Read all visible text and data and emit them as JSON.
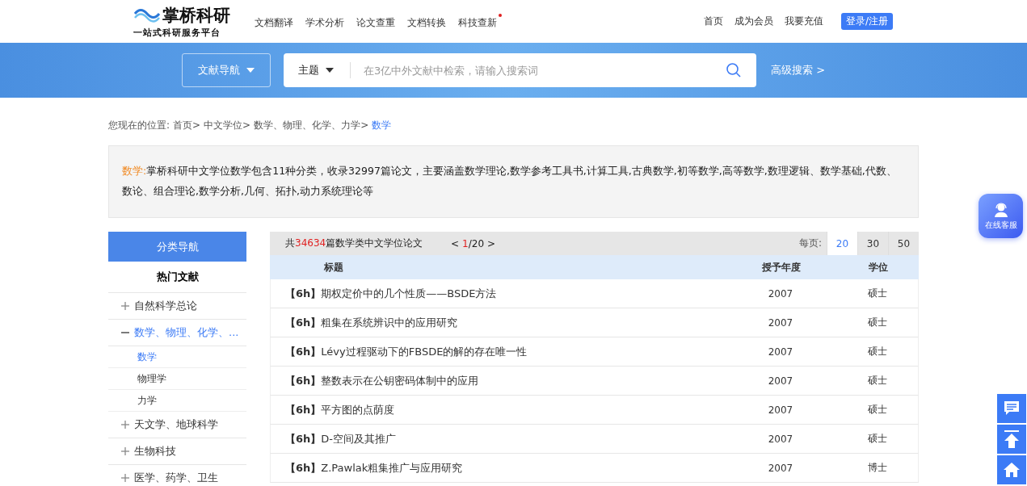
{
  "logo": {
    "name": "掌桥科研",
    "slogan": "一站式科研服务平台"
  },
  "nav": [
    {
      "label": "文档翻译",
      "dot": false
    },
    {
      "label": "学术分析",
      "dot": false
    },
    {
      "label": "论文查重",
      "dot": false
    },
    {
      "label": "文档转换",
      "dot": false
    },
    {
      "label": "科技查新",
      "dot": true
    }
  ],
  "user_links": [
    "首页",
    "成为会员",
    "我要充值"
  ],
  "login_button": "登录/注册",
  "search": {
    "nav_button": "文献导航",
    "scope": "主题",
    "placeholder": "在3亿中外文献中检索，请输入搜索词",
    "advanced": "高级搜索 >"
  },
  "breadcrumb": {
    "label": "您现在的位置:",
    "items": [
      "首页>",
      "中文学位>",
      "数学、物理、化学、力学>"
    ],
    "current": "数学"
  },
  "description": {
    "label": "数学:",
    "text": "掌桥科研中文学位数学包含11种分类，收录32997篇论文，主要涵盖数学理论,数学参考工具书,计算工具,古典数学,初等数学,高等数学,数理逻辑、数学基础,代数、数论、组合理论,数学分析,几何、拓扑,动力系统理论等"
  },
  "sidebar": {
    "title": "分类导航",
    "subtitle": "热门文献",
    "items": [
      {
        "label": "自然科学总论",
        "expanded": false
      },
      {
        "label": "数学、物理、化学、...",
        "expanded": true,
        "children": [
          {
            "label": "数学",
            "selected": true
          },
          {
            "label": "物理学",
            "selected": false
          },
          {
            "label": "力学",
            "selected": false
          }
        ]
      },
      {
        "label": "天文学、地球科学",
        "expanded": false
      },
      {
        "label": "生物科技",
        "expanded": false
      },
      {
        "label": "医学、药学、卫生",
        "expanded": false
      }
    ]
  },
  "results": {
    "total_prefix": "共",
    "total": "34634",
    "total_suffix": "篇数学类中文学位论文",
    "pager": {
      "prev": "<",
      "current": "1",
      "total": "/20",
      "next": ">"
    },
    "per_page_label": "每页:",
    "per_page": [
      {
        "label": "20",
        "selected": true
      },
      {
        "label": "30",
        "selected": false
      },
      {
        "label": "50",
        "selected": false
      }
    ]
  },
  "table": {
    "columns": [
      "标题",
      "授予年度",
      "学位"
    ],
    "rows": [
      {
        "tag": "【6h】",
        "title": "期权定价中的几个性质——BSDE方法",
        "year": "2007",
        "degree": "硕士"
      },
      {
        "tag": "【6h】",
        "title": "粗集在系统辨识中的应用研究",
        "year": "2007",
        "degree": "硕士"
      },
      {
        "tag": "【6h】",
        "title": "Lévy过程驱动下的FBSDE的解的存在唯一性",
        "year": "2007",
        "degree": "硕士"
      },
      {
        "tag": "【6h】",
        "title": "整数表示在公钥密码体制中的应用",
        "year": "2007",
        "degree": "硕士"
      },
      {
        "tag": "【6h】",
        "title": "平方图的点荫度",
        "year": "2007",
        "degree": "硕士"
      },
      {
        "tag": "【6h】",
        "title": "D-空间及其推广",
        "year": "2007",
        "degree": "硕士"
      },
      {
        "tag": "【6h】",
        "title": "Z.Pawlak粗集推广与应用研究",
        "year": "2007",
        "degree": "博士"
      }
    ]
  },
  "service_button": "在线客服"
}
